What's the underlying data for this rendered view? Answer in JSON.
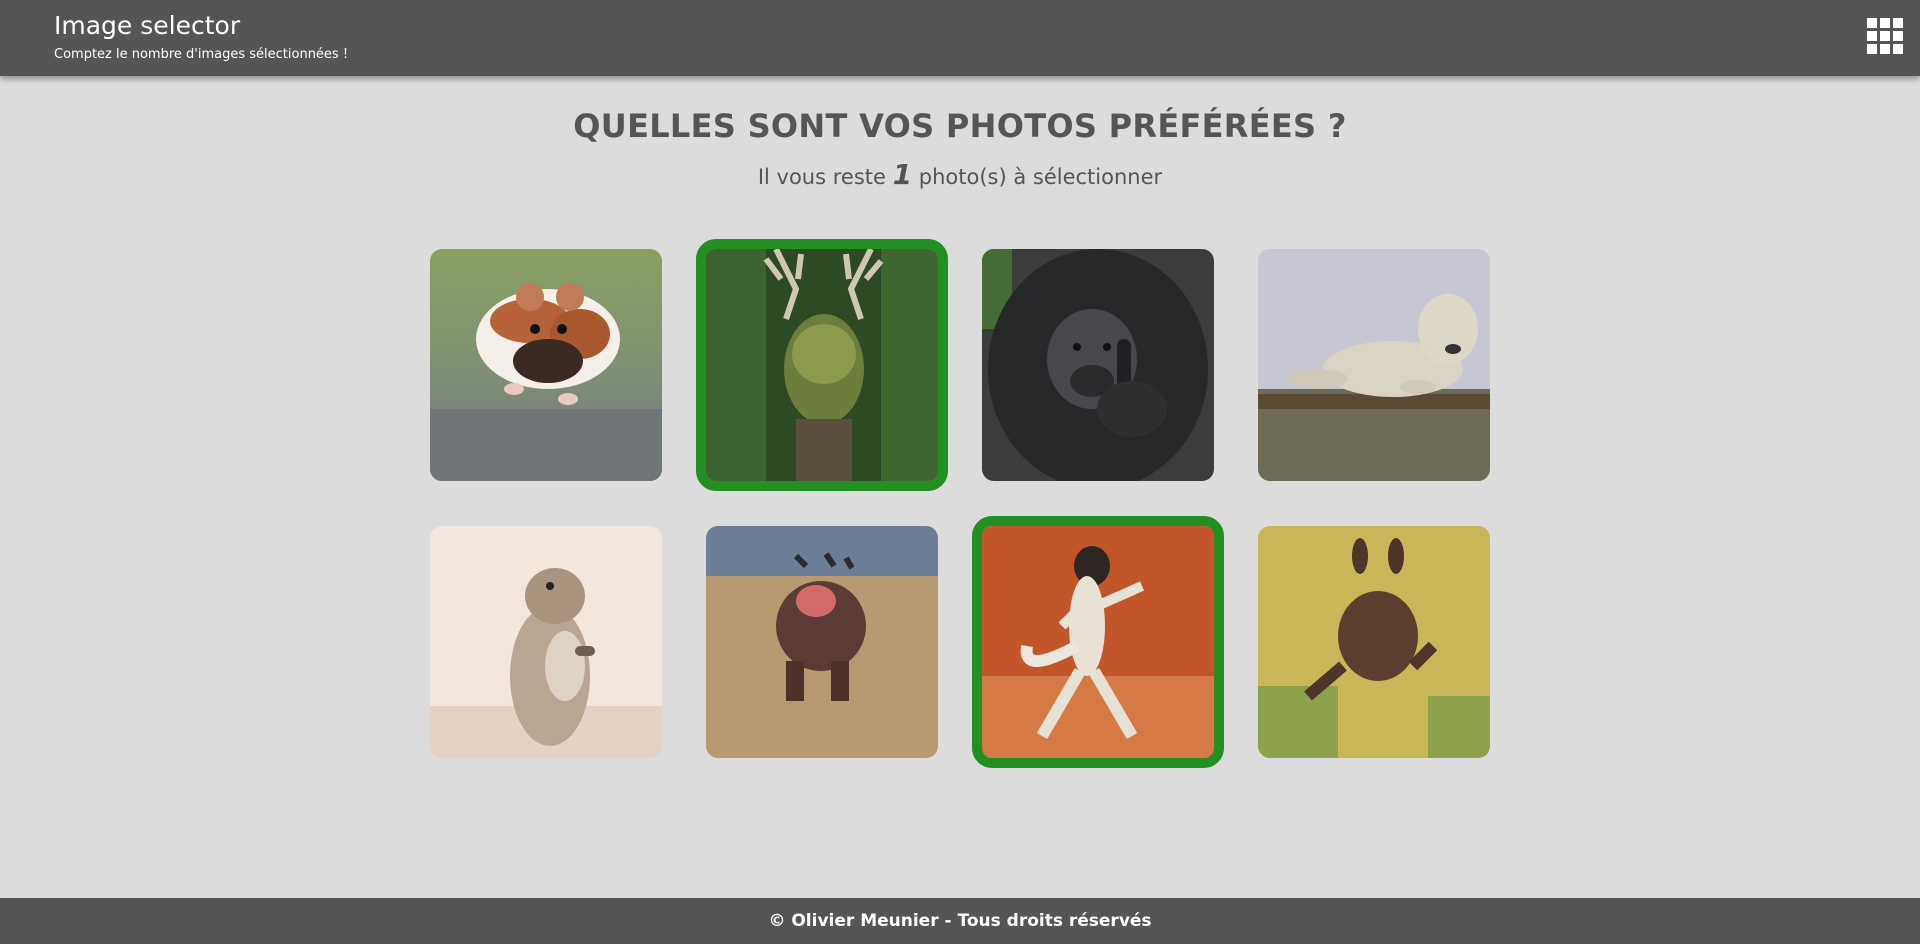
{
  "header": {
    "title": "Image selector",
    "subtitle": "Comptez le nombre d'images sélectionnées !",
    "menu_icon": "grid-menu-icon"
  },
  "main": {
    "heading": "QUELLES SONT VOS PHOTOS PRÉFÉRÉES ?",
    "counter_prefix": "Il vous reste",
    "remaining": "1",
    "counter_suffix": "photo(s) à sélectionner"
  },
  "photos": [
    {
      "subject": "hamster",
      "selected": false
    },
    {
      "subject": "stag",
      "selected": true
    },
    {
      "subject": "gorilla",
      "selected": false
    },
    {
      "subject": "seal",
      "selected": false
    },
    {
      "subject": "ground-squirrel",
      "selected": false
    },
    {
      "subject": "hippo",
      "selected": false
    },
    {
      "subject": "lemur",
      "selected": true
    },
    {
      "subject": "squirrel",
      "selected": false
    }
  ],
  "colors": {
    "header_bg": "#555555",
    "page_bg": "#dcdcdc",
    "selected_border": "#238f23",
    "text": "#555555"
  },
  "footer": {
    "text": "© Olivier Meunier - Tous droits réservés"
  }
}
